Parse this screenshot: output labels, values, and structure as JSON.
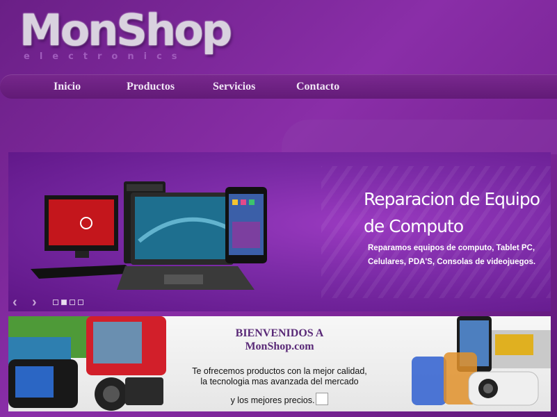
{
  "logo": {
    "main": "MonShop",
    "sub": "electronics"
  },
  "nav": {
    "items": [
      "Inicio",
      "Productos",
      "Servicios",
      "Contacto"
    ]
  },
  "slider": {
    "title_line1": "Reparacion de Equipo",
    "title_line2": "de Computo",
    "desc_line1": "Reparamos equipos de computo, Tablet PC,",
    "desc_line2": "Celulares, PDA'S,  Consolas de videojuegos.",
    "prev_icon": "‹",
    "next_icon": "›",
    "active_dot": 2
  },
  "welcome": {
    "title_line1": "BIENVENIDOS A",
    "title_line2": "MonShop.com",
    "text_line1": "Te ofrecemos productos con la mejor calidad,",
    "text_line2": "la tecnologia mas avanzada del mercado",
    "text_line3": "y los mejores precios."
  },
  "colors": {
    "accent": "#7b2597",
    "title": "#5a2a78"
  }
}
